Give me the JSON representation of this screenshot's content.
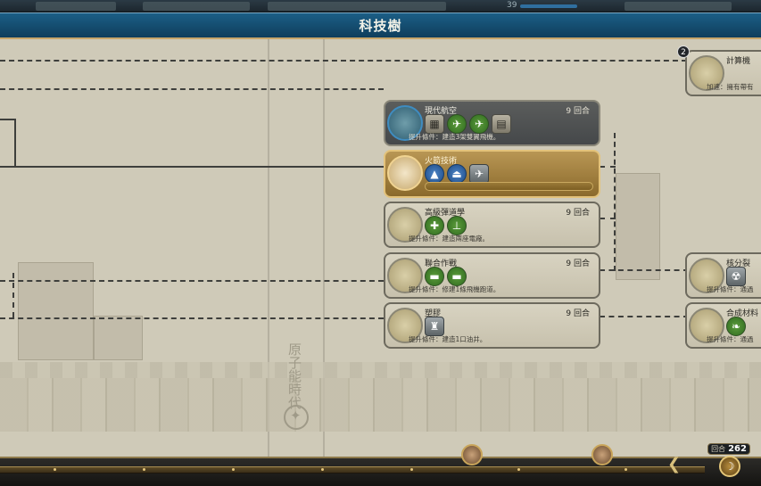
{
  "header": {
    "title": "科技樹"
  },
  "top_strip": {
    "value": "39"
  },
  "era_label": "原子能時代",
  "techs": [
    {
      "name": "現代航空",
      "turns": "9 回合",
      "requirement": "提升條件：建造3架雙翼飛機。",
      "state": "researched",
      "icons": [
        "hangar-icon",
        "biplane-icon",
        "fighter-icon",
        "document-icon"
      ]
    },
    {
      "name": "火箭技術",
      "turns": "",
      "requirement": "",
      "state": "researching",
      "icons": [
        "rocket-unit-icon",
        "missile-icon",
        "jet-icon"
      ]
    },
    {
      "name": "高級彈道學",
      "turns": "9 回合",
      "requirement": "提升條件：建造兩座電廠。",
      "state": "available",
      "icons": [
        "artillery-icon",
        "machine-gun-icon"
      ]
    },
    {
      "name": "聯合作戰",
      "turns": "9 回合",
      "requirement": "提升條件：修建1條飛機跑道。",
      "state": "available",
      "icons": [
        "warship-icon",
        "submarine-icon"
      ]
    },
    {
      "name": "塑膠",
      "turns": "9 回合",
      "requirement": "提升條件：建造1口油井。",
      "state": "available",
      "icons": [
        "oil-rig-icon"
      ]
    }
  ],
  "side_techs": [
    {
      "name": "計算機",
      "requirement": "加速：擁有帶有",
      "badge": "2"
    },
    {
      "name": "核分裂",
      "requirement": "提升條件：通過"
    },
    {
      "name": "合成材料",
      "requirement": "提升條件：通過"
    }
  ],
  "bottom": {
    "turn_label": "回合",
    "turn_number": "262"
  }
}
